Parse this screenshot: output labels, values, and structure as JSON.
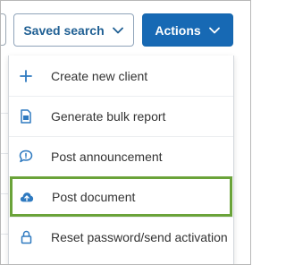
{
  "toolbar": {
    "saved_search_label": "Saved search",
    "actions_label": "Actions"
  },
  "menu": {
    "items": [
      {
        "label": "Create new client",
        "icon": "plus-icon"
      },
      {
        "label": "Generate bulk report",
        "icon": "document-icon"
      },
      {
        "label": "Post announcement",
        "icon": "speech-bubble-icon"
      },
      {
        "label": "Post document",
        "icon": "cloud-upload-icon",
        "highlighted": true
      },
      {
        "label": "Reset password/send activation",
        "icon": "lock-icon"
      }
    ]
  },
  "colors": {
    "primary": "#1769b4",
    "icon_blue": "#2f7ac0",
    "highlight_border": "#6aa339",
    "outline_button_text": "#1f5f93"
  }
}
